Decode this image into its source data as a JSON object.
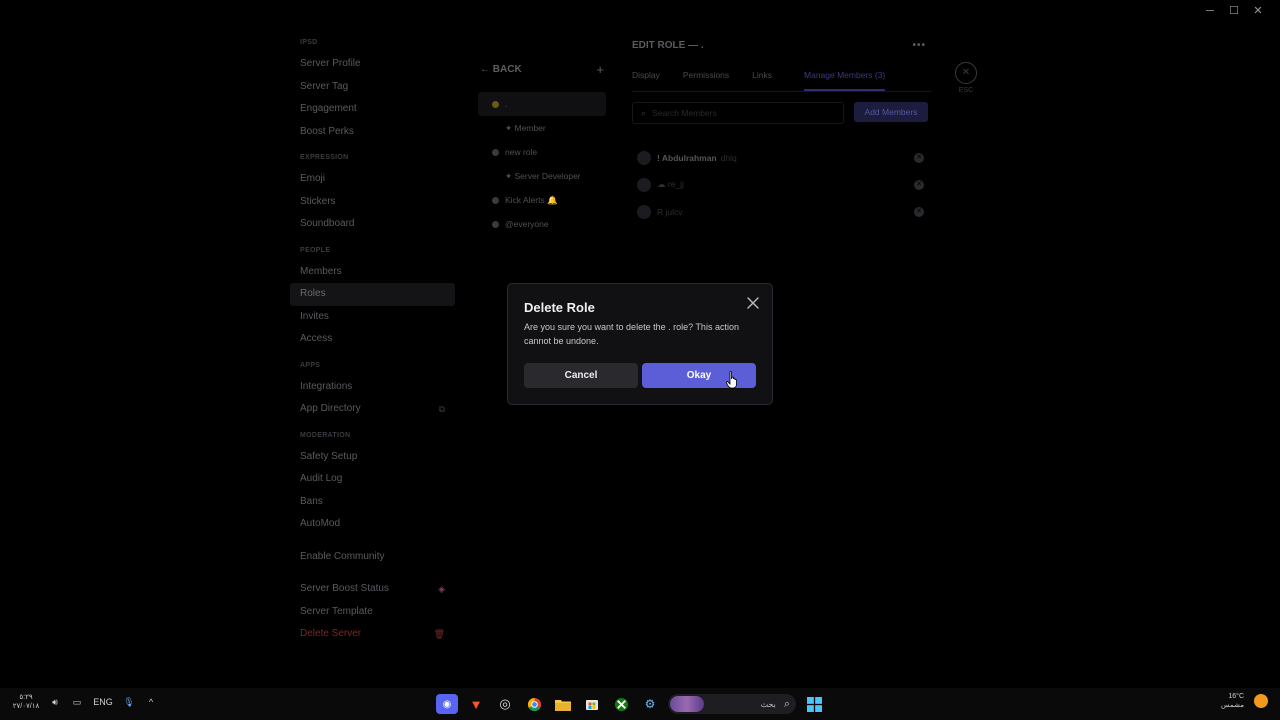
{
  "window": {
    "controls": [
      "─",
      "☐",
      "✕"
    ]
  },
  "sidebar": {
    "header_cat": "IPSD",
    "top_items": [
      "Server Profile",
      "Server Tag",
      "Engagement",
      "Boost Perks"
    ],
    "expression_cat": "EXPRESSION",
    "expression_items": [
      "Emoji",
      "Stickers",
      "Soundboard"
    ],
    "people_cat": "PEOPLE",
    "people_items": [
      "Members",
      "Roles",
      "Invites",
      "Access"
    ],
    "apps_cat": "APPS",
    "apps_items": [
      "Integrations",
      "App Directory"
    ],
    "moderation_cat": "MODERATION",
    "moderation_items": [
      "Safety Setup",
      "Audit Log",
      "Bans",
      "AutoMod"
    ],
    "enable_community": "Enable Community",
    "boost_status": "Server Boost Status",
    "server_template": "Server Template",
    "delete_server": "Delete Server"
  },
  "roles": {
    "back_label": "BACK",
    "add_icon": "+",
    "list": [
      {
        "name": ".",
        "dot": "yellow"
      },
      {
        "name": "✦ Member",
        "dot": "none"
      },
      {
        "name": "new role",
        "dot": "gray"
      },
      {
        "name": "✦ Server Developer",
        "dot": "none"
      },
      {
        "name": "Kick Alerts 🔔",
        "dot": "gray"
      },
      {
        "name": "@everyone",
        "dot": "gray"
      }
    ]
  },
  "edit": {
    "title": "EDIT ROLE — .",
    "more_icon": "•••",
    "tabs": [
      "Display",
      "Permissions",
      "Links",
      "Manage Members (3)"
    ],
    "search_placeholder": "Search Members",
    "add_members": "Add Members",
    "members": [
      {
        "name": "! Abdulrahman",
        "tag": "dhlq"
      },
      {
        "name": "☁ re_jj",
        "tag": ""
      },
      {
        "name": "R julcv",
        "tag": ""
      }
    ],
    "esc_label": "ESC"
  },
  "modal": {
    "title": "Delete Role",
    "message": "Are you sure you want to delete the . role? This action cannot be undone.",
    "cancel": "Cancel",
    "okay": "Okay"
  },
  "taskbar": {
    "time": "٥:٢٩",
    "date": "٢٧/٠٧/١٨",
    "lang": "ENG",
    "search_text": "بحث",
    "temperature": "16°C",
    "weather": "مشمس"
  },
  "colors": {
    "accent": "#5b5ed6",
    "danger": "#7a2727"
  }
}
